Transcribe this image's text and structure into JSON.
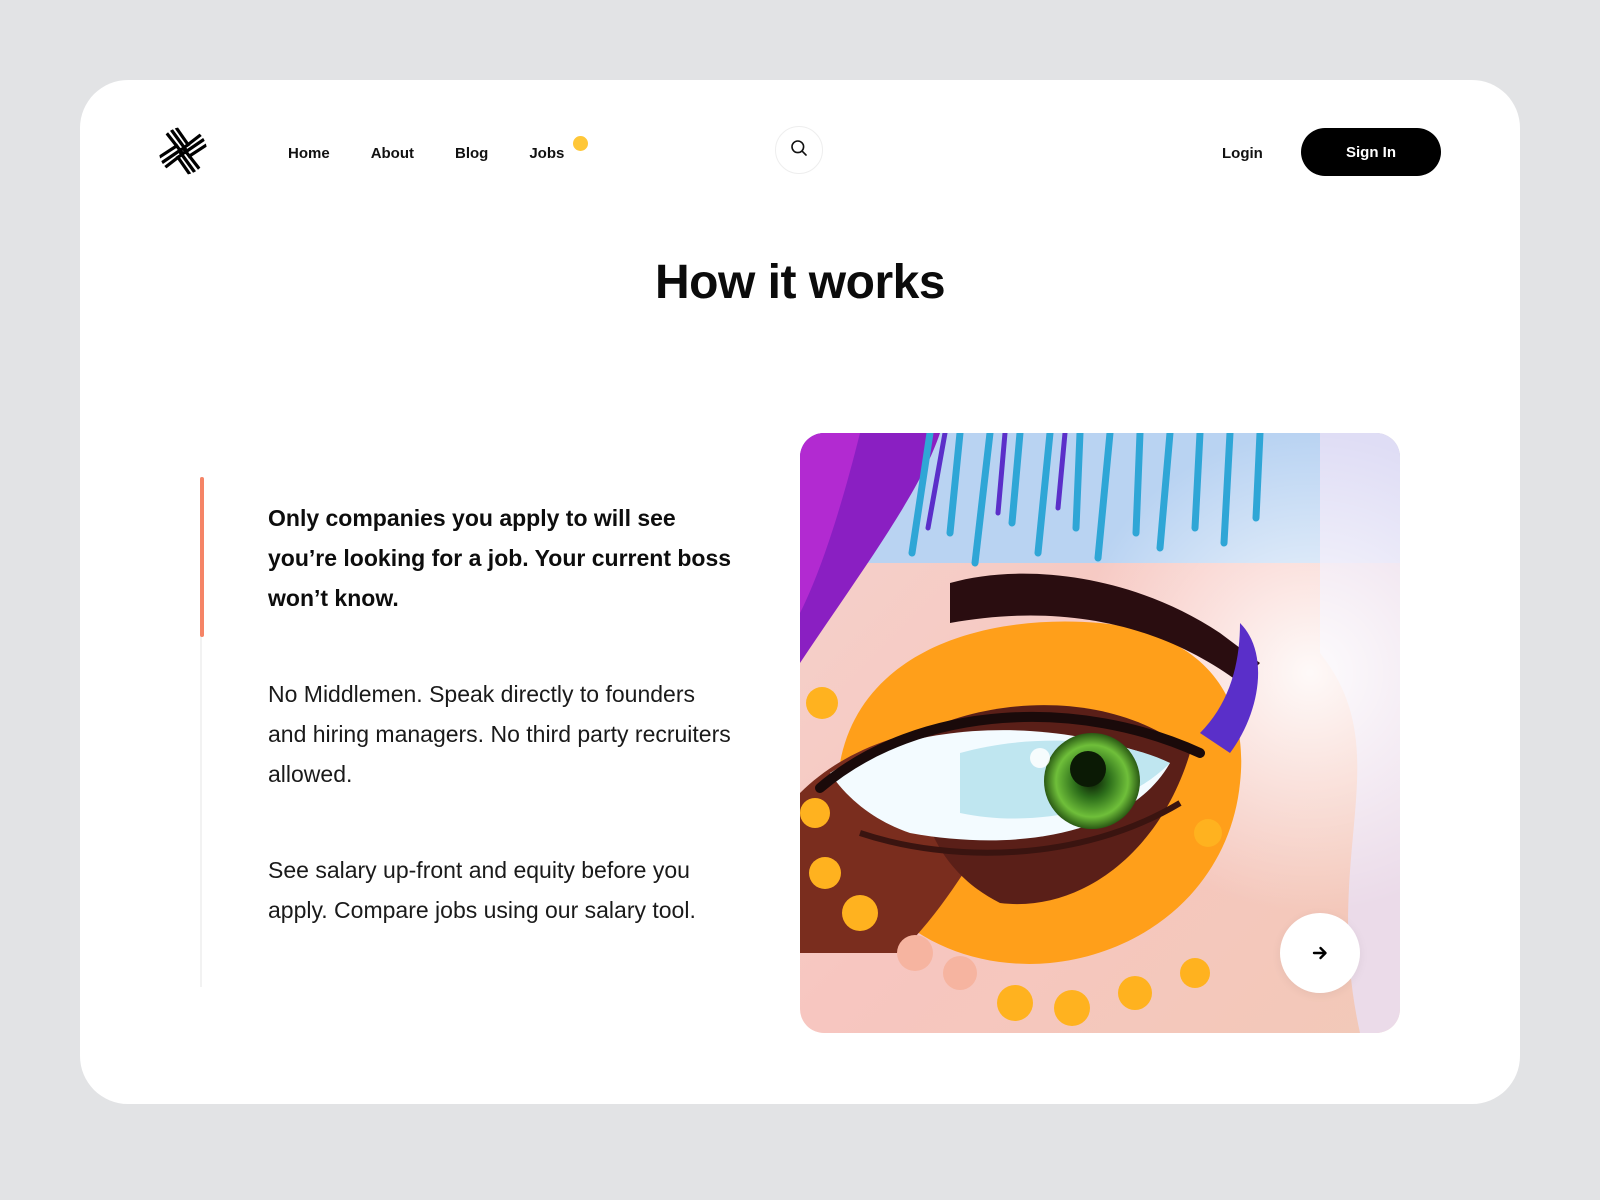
{
  "nav": {
    "items": [
      {
        "label": "Home"
      },
      {
        "label": "About"
      },
      {
        "label": "Blog"
      },
      {
        "label": "Jobs",
        "has_notification_dot": true
      }
    ],
    "notification_dot_color": "#ffc738"
  },
  "header": {
    "search_icon": "search-icon",
    "login_label": "Login",
    "signin_label": "Sign In"
  },
  "main": {
    "title": "How it works",
    "features": [
      {
        "text": "Only companies you apply to will see you’re looking for a job. Your current boss won’t know.",
        "active": true
      },
      {
        "text": "No Middlemen. Speak directly to founders and hiring managers. No third party recruiters allowed.",
        "active": false
      },
      {
        "text": "See salary up-front and equity before you apply. Compare jobs using our salary tool.",
        "active": false
      }
    ],
    "active_accent_color": "#f58466",
    "image": {
      "subject": "colorful painted eye artwork",
      "next_icon": "arrow-right-icon"
    }
  },
  "colors": {
    "background": "#e2e3e5",
    "card": "#ffffff",
    "primary_button": "#000000"
  }
}
